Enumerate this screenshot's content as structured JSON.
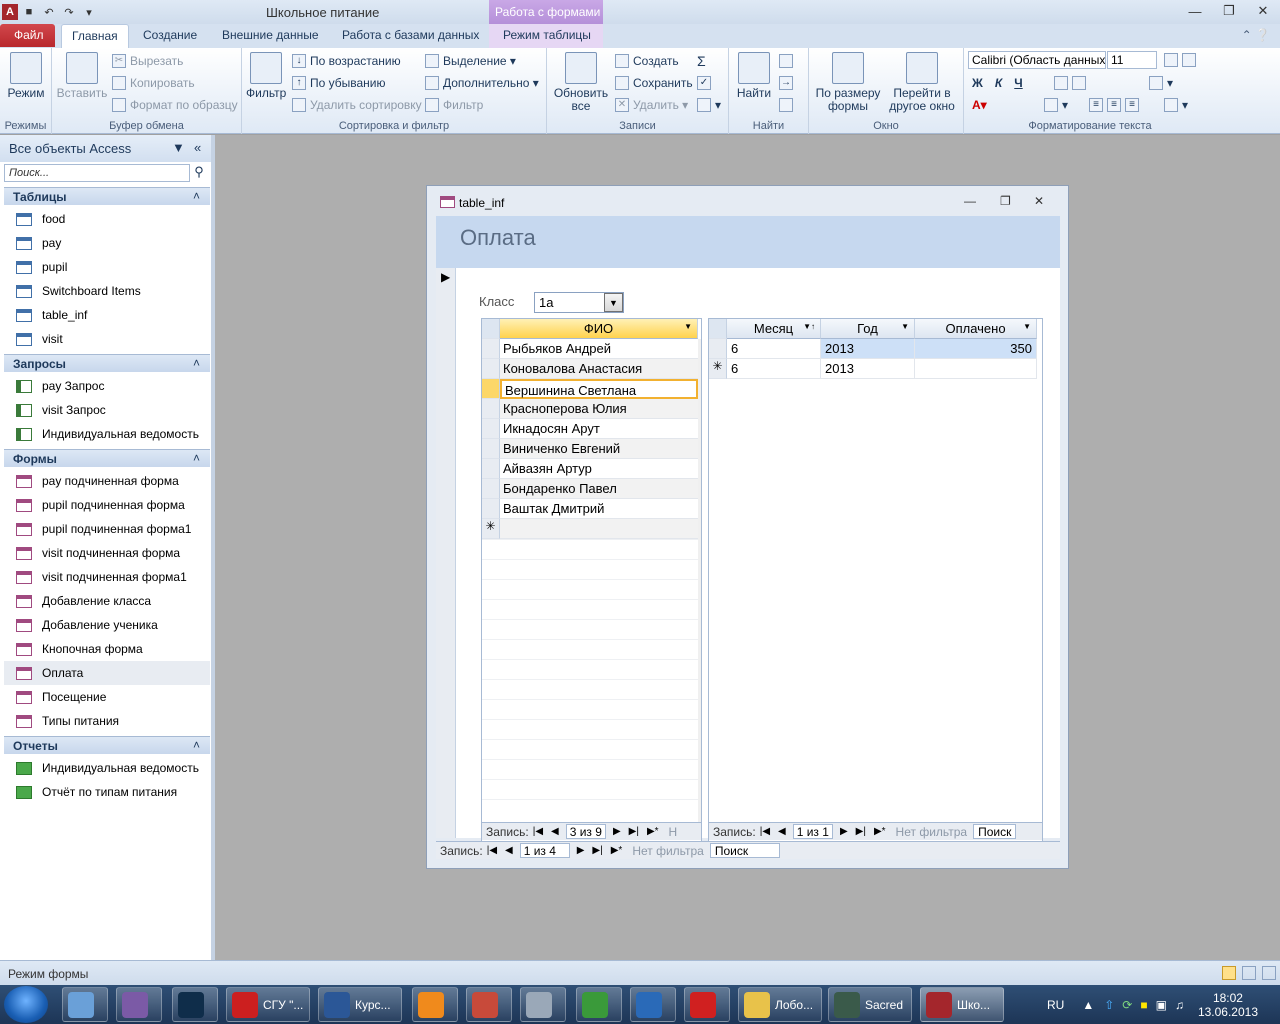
{
  "app": {
    "title": "Школьное питание",
    "context_group": "Работа с формами"
  },
  "ribbon_tabs": {
    "file": "Файл",
    "home": "Главная",
    "create": "Создание",
    "external": "Внешние данные",
    "db": "Работа с базами данных",
    "table_mode": "Режим таблицы"
  },
  "ribbon": {
    "views": {
      "mode": "Режим",
      "group": "Режимы"
    },
    "clipboard": {
      "paste": "Вставить",
      "cut": "Вырезать",
      "copy": "Копировать",
      "format_painter": "Формат по образцу",
      "group": "Буфер обмена"
    },
    "sort_filter": {
      "filter": "Фильтр",
      "asc": "По возрастанию",
      "desc": "По убыванию",
      "remove_sort": "Удалить сортировку",
      "selection": "Выделение",
      "advanced": "Дополнительно",
      "toggle_filter": "Фильтр",
      "group": "Сортировка и фильтр"
    },
    "records": {
      "refresh": "Обновить",
      "refresh2": "все",
      "new": "Создать",
      "save": "Сохранить",
      "delete": "Удалить",
      "group": "Записи"
    },
    "find": {
      "find": "Найти",
      "group": "Найти"
    },
    "window": {
      "fit": "По размеру",
      "fit2": "формы",
      "switch": "Перейти в",
      "switch2": "другое окно",
      "group": "Окно"
    },
    "text": {
      "font": "Calibri (Область данных)",
      "size": "11",
      "group": "Форматирование текста"
    }
  },
  "nav": {
    "header": "Все объекты Access",
    "search_placeholder": "Поиск...",
    "sections": {
      "tables": {
        "title": "Таблицы",
        "items": [
          "food",
          "pay",
          "pupil",
          "Switchboard Items",
          "table_inf",
          "visit"
        ]
      },
      "queries": {
        "title": "Запросы",
        "items": [
          "pay Запрос",
          "visit Запрос",
          "Индивидуальная ведомость"
        ]
      },
      "forms": {
        "title": "Формы",
        "items": [
          "pay подчиненная форма",
          "pupil подчиненная форма",
          "pupil подчиненная форма1",
          "visit подчиненная форма",
          "visit подчиненная форма1",
          "Добавление класса",
          "Добавление ученика",
          "Кнопочная форма",
          "Оплата",
          "Посещение",
          "Типы питания"
        ]
      },
      "reports": {
        "title": "Отчеты",
        "items": [
          "Индивидуальная ведомость",
          "Отчёт по типам питания"
        ]
      }
    }
  },
  "form": {
    "window_title": "table_inf",
    "header": "Оплата",
    "class_label": "Класс",
    "class_value": "1а",
    "pupils": {
      "column": "ФИО",
      "rows": [
        "Рыбьяков Андрей",
        "Коновалова Анастасия",
        "Вершинина Светлана",
        "Красноперова Юлия",
        "Икнадосян Арут",
        "Виниченко Евгений",
        "Айвазян Артур",
        "Бондаренко Павел",
        "Ваштак Дмитрий"
      ],
      "record_label": "Запись:",
      "record_pos": "3 из 9",
      "filter_trunc": "Н"
    },
    "payments": {
      "columns": [
        "Месяц",
        "Год",
        "Оплачено"
      ],
      "rows": [
        [
          "6",
          "2013",
          "350"
        ],
        [
          "6",
          "2013",
          ""
        ]
      ],
      "record_label": "Запись:",
      "record_pos": "1 из 1",
      "no_filter": "Нет фильтра",
      "search": "Поиск"
    },
    "main_nav": {
      "record_label": "Запись:",
      "record_pos": "1 из 4",
      "no_filter": "Нет фильтра",
      "search": "Поиск"
    }
  },
  "status": {
    "text": "Режим формы"
  },
  "taskbar": {
    "items": [
      {
        "label": "СГУ \"...",
        "color": "#cc1f1f"
      },
      {
        "label": "Курс...",
        "color": "#2b5797"
      },
      {
        "label": "Лобо...",
        "color": "#e8c24a"
      },
      {
        "label": "Sacred",
        "color": "#3a5a4a"
      },
      {
        "label": "Шко...",
        "color": "#a4262c"
      }
    ],
    "lang": "RU",
    "time": "18:02",
    "date": "13.06.2013"
  }
}
